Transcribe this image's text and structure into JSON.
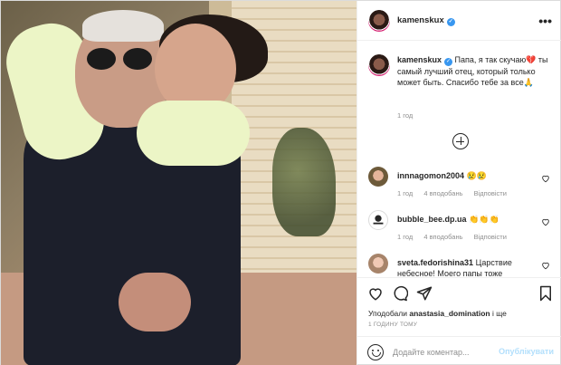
{
  "post": {
    "username": "kamenskux",
    "verified_mark": "✓",
    "more_label": "•••"
  },
  "caption": {
    "username": "kamenskux",
    "text": "Папа, я так скучаю💔 ты самый лучший отец, который только может быть. Спасибо тебе за все🙏",
    "time": "1 год"
  },
  "comments": [
    {
      "username": "innnagomon2004",
      "text": "😢😢",
      "time": "1 год",
      "likes": "4 вподобань",
      "reply": "Відповісти"
    },
    {
      "username": "bubble_bee.dp.ua",
      "text": "👏👏👏",
      "time": "1 год",
      "likes": "4 вподобань",
      "reply": "Відповісти"
    },
    {
      "username": "sveta.fedorishina31",
      "text": "Царствие небесное! Моего папы тоже",
      "time": "",
      "likes": "",
      "reply": ""
    }
  ],
  "actions": {
    "liked_prefix": "Уподобали",
    "liked_user": "anastasia_domination",
    "liked_suffix": "і ще",
    "time_ago": "1 ГОДИНУ ТОМУ"
  },
  "add_comment": {
    "placeholder": "Додайте коментар...",
    "publish_label": "Опублікувати"
  },
  "colors": {
    "accent_blue": "#3897f0",
    "publish_disabled": "#b2dffc",
    "muted_text": "#8e8e8e"
  },
  "icons": [
    "more-icon",
    "add-icon",
    "heart-icon",
    "comment-icon",
    "share-icon",
    "bookmark-icon",
    "emoji-icon",
    "verified-icon"
  ]
}
